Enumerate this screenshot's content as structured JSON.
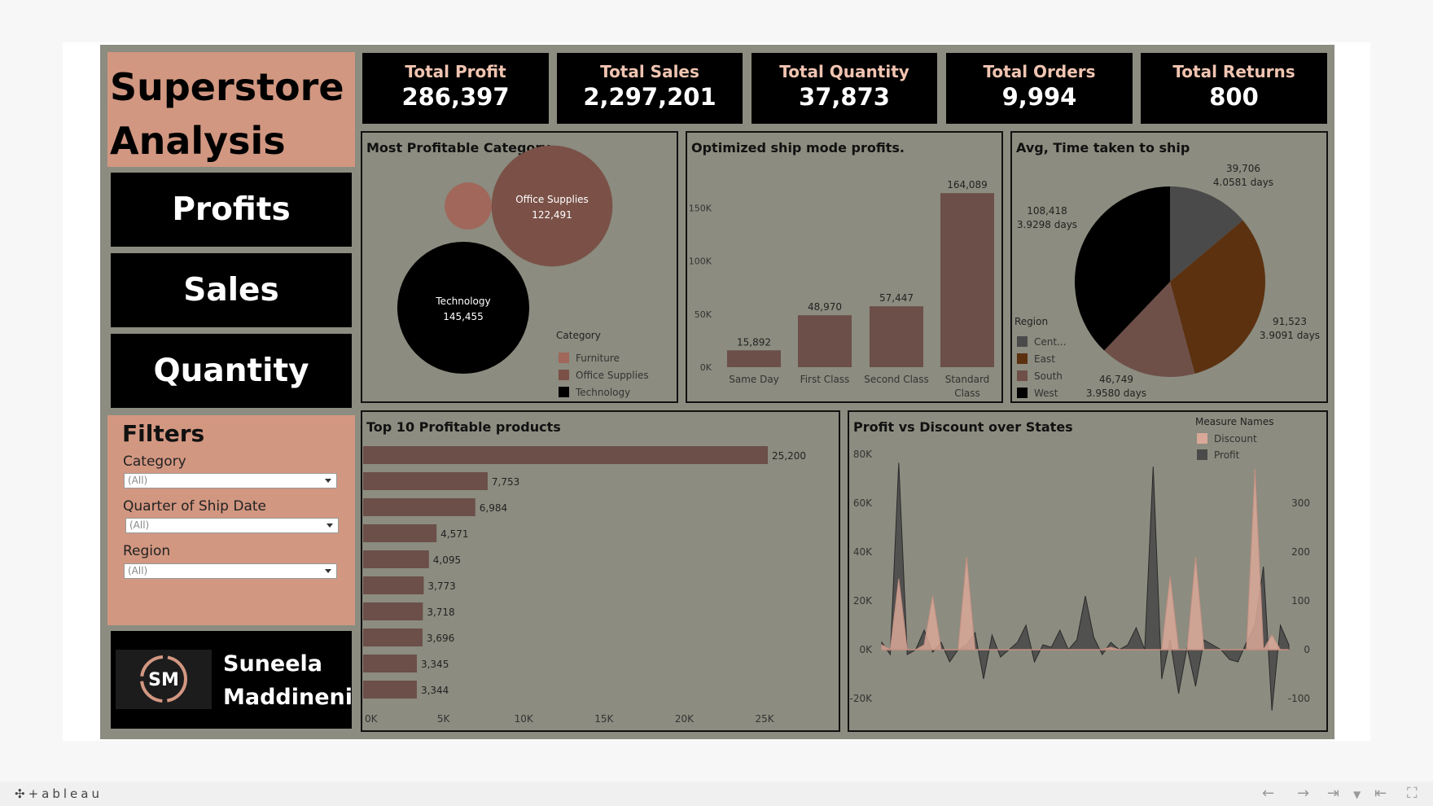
{
  "dashboard": {
    "title_line1": "Superstore",
    "title_line2": "Analysis",
    "nav": [
      "Profits",
      "Sales",
      "Quantity"
    ],
    "author_line1": "Suneela",
    "author_line2": "Maddineni",
    "logo_text": "SM"
  },
  "kpis": [
    {
      "label": "Total Profit",
      "value": "286,397"
    },
    {
      "label": "Total Sales",
      "value": "2,297,201"
    },
    {
      "label": "Total Quantity",
      "value": "37,873"
    },
    {
      "label": "Total Orders",
      "value": "9,994"
    },
    {
      "label": "Total Returns",
      "value": "800"
    }
  ],
  "filters": {
    "heading": "Filters",
    "items": [
      {
        "label": "Category",
        "value": "(All)"
      },
      {
        "label": "Quarter of Ship Date",
        "value": "(All)"
      },
      {
        "label": "Region",
        "value": "(All)"
      }
    ]
  },
  "colors": {
    "bar": "#6b4f48",
    "furniture": "#a0675a",
    "office_supplies": "#7b5147",
    "technology": "#000000",
    "central": "#4a4a4a",
    "east": "#5c3110",
    "south": "#6e5049",
    "west": "#000000",
    "discount": "#d9a899",
    "profit": "#4a4a4a"
  },
  "chart_data": [
    {
      "id": "category_bubbles",
      "type": "bubble",
      "title": "Most Profitable Category",
      "legend_title": "Category",
      "legend": [
        "Furniture",
        "Office Supplies",
        "Technology"
      ],
      "items": [
        {
          "name": "Furniture",
          "value": 18451,
          "label": ""
        },
        {
          "name": "Office Supplies",
          "value": 122491,
          "label": "Office Supplies",
          "value_label": "122,491"
        },
        {
          "name": "Technology",
          "value": 145455,
          "label": "Technology",
          "value_label": "145,455"
        }
      ]
    },
    {
      "id": "ship_mode",
      "type": "bar",
      "title": "Optimized ship mode profits.",
      "categories": [
        "Same Day",
        "First Class",
        "Second Class",
        "Standard Class"
      ],
      "category_lines": [
        [
          "Same Day"
        ],
        [
          "First Class"
        ],
        [
          "Second Class"
        ],
        [
          "Standard",
          "Class"
        ]
      ],
      "values": [
        15892,
        48970,
        57447,
        164089
      ],
      "value_labels": [
        "15,892",
        "48,970",
        "57,447",
        "164,089"
      ],
      "yticks": [
        "0K",
        "50K",
        "100K",
        "150K"
      ],
      "ylim": [
        0,
        175000
      ]
    },
    {
      "id": "ship_time",
      "type": "pie",
      "title": "Avg, Time taken to ship",
      "legend_title": "Region",
      "legend": [
        "Cent...",
        "East",
        "South",
        "West"
      ],
      "slices": [
        {
          "region": "Central",
          "value": 39706,
          "label1": "39,706",
          "label2": "4.0581 days"
        },
        {
          "region": "East",
          "value": 91523,
          "label1": "91,523",
          "label2": "3.9091 days"
        },
        {
          "region": "South",
          "value": 46749,
          "label1": "46,749",
          "label2": "3.9580 days"
        },
        {
          "region": "West",
          "value": 108418,
          "label1": "108,418",
          "label2": "3.9298 days"
        }
      ]
    },
    {
      "id": "top_products",
      "type": "bar",
      "orientation": "horizontal",
      "title": "Top 10 Profitable products",
      "values": [
        25200,
        7753,
        6984,
        4571,
        4095,
        3773,
        3718,
        3696,
        3345,
        3344
      ],
      "value_labels": [
        "25,200",
        "7,753",
        "6,984",
        "4,571",
        "4,095",
        "3,773",
        "3,718",
        "3,696",
        "3,345",
        "3,344"
      ],
      "xticks": [
        "0K",
        "5K",
        "10K",
        "15K",
        "20K",
        "25K"
      ],
      "xlim": [
        0,
        29000
      ]
    },
    {
      "id": "profit_discount",
      "type": "area",
      "title": "Profit vs Discount over States",
      "legend_title": "Measure Names",
      "legend": [
        "Discount",
        "Profit"
      ],
      "left_ticks": [
        "80K",
        "60K",
        "40K",
        "20K",
        "0K",
        "-20K"
      ],
      "right_ticks": [
        "300",
        "200",
        "100",
        "0",
        "-100"
      ],
      "series": [
        {
          "name": "Profit",
          "values": [
            3000,
            -2000,
            76500,
            -2000,
            0,
            8000,
            -1000,
            3000,
            -5000,
            0,
            2000,
            7000,
            -12000,
            6000,
            -3000,
            0,
            3000,
            10000,
            -5000,
            2000,
            1000,
            8000,
            0,
            4000,
            22000,
            5000,
            -2000,
            3000,
            0,
            2000,
            9000,
            0,
            75000,
            -12000,
            4000,
            -18000,
            1000,
            -15000,
            4000,
            2000,
            0,
            -4000,
            -5000,
            3000,
            10000,
            34000,
            -25000,
            10000,
            2000
          ]
        },
        {
          "name": "Discount",
          "values": [
            10,
            0,
            145,
            0,
            0,
            10,
            110,
            0,
            0,
            0,
            190,
            0,
            0,
            0,
            0,
            0,
            0,
            0,
            0,
            0,
            0,
            0,
            0,
            0,
            0,
            0,
            0,
            5,
            0,
            0,
            0,
            0,
            0,
            0,
            150,
            0,
            0,
            190,
            0,
            0,
            0,
            0,
            0,
            0,
            370,
            0,
            30,
            0,
            0
          ]
        }
      ]
    }
  ]
}
